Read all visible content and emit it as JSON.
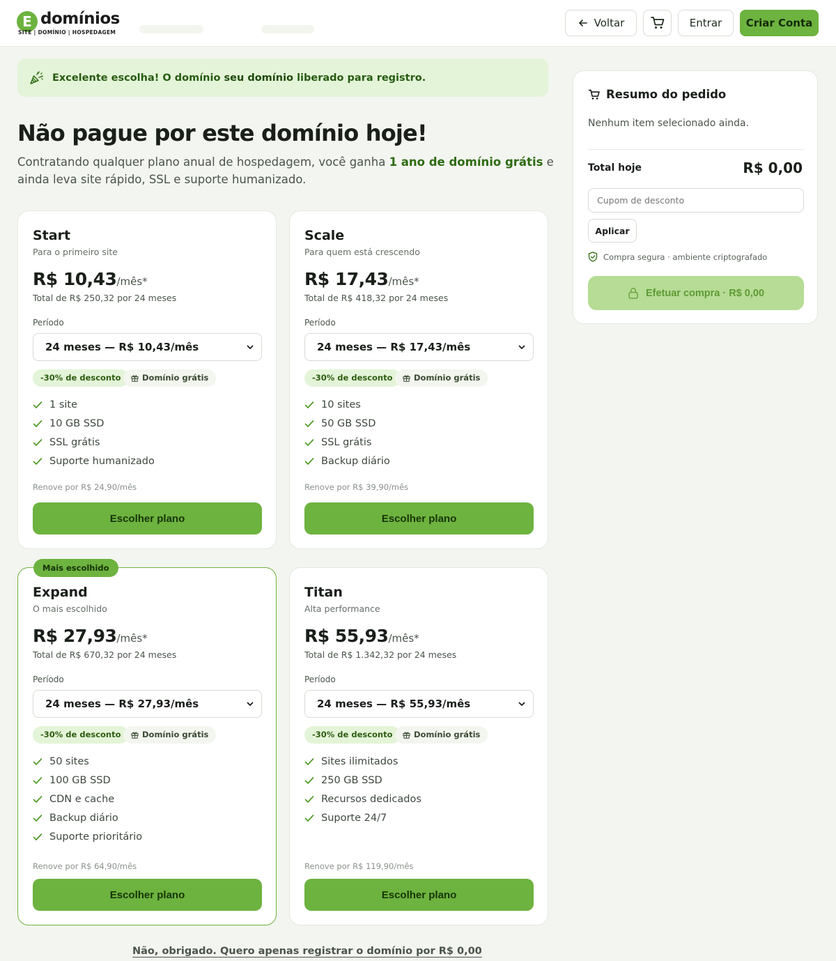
{
  "header": {
    "logo_letter": "E",
    "logo_word": "domínios",
    "logo_tagline": "SITE | DOMÍNIO | HOSPEDAGEM",
    "back_label": "Voltar",
    "login_label": "Entrar",
    "signup_label": "Criar Conta"
  },
  "banner": {
    "prefix": "Excelente escolha! O domínio ",
    "domain": "seu domínio",
    "suffix": " liberado para registro."
  },
  "hero": {
    "title": "Não pague por este domínio hoje!",
    "desc_before": "Contratando qualquer plano anual de hospedagem, você ganha ",
    "desc_highlight": "1 ano de domínio grátis",
    "desc_after": " e ainda leva site rápido, SSL e suporte humanizado."
  },
  "common": {
    "period_label": "Período",
    "per_month": "/mês*",
    "discount_chip": "-30% de desconto",
    "domain_chip": "Domínio grátis",
    "choose_label": "Escolher plano",
    "featured_ribbon": "Mais escolhido"
  },
  "plans": [
    {
      "name": "Start",
      "subtitle": "Para o primeiro site",
      "price": "R$ 10,43",
      "total": "Total de R$ 250,32 por 24 meses",
      "period": "24 meses — R$ 10,43/mês",
      "features": [
        "1 site",
        "10 GB SSD",
        "SSL grátis",
        "Suporte humanizado"
      ],
      "renew": "Renove por R$ 24,90/mês"
    },
    {
      "name": "Scale",
      "subtitle": "Para quem está crescendo",
      "price": "R$ 17,43",
      "total": "Total de R$ 418,32 por 24 meses",
      "period": "24 meses — R$ 17,43/mês",
      "features": [
        "10 sites",
        "50 GB SSD",
        "SSL grátis",
        "Backup diário"
      ],
      "renew": "Renove por R$ 39,90/mês"
    },
    {
      "name": "Expand",
      "subtitle": "O mais escolhido",
      "price": "R$ 27,93",
      "total": "Total de R$ 670,32 por 24 meses",
      "period": "24 meses — R$ 27,93/mês",
      "features": [
        "50 sites",
        "100 GB SSD",
        "CDN e cache",
        "Backup diário",
        "Suporte prioritário"
      ],
      "renew": "Renove por R$ 64,90/mês"
    },
    {
      "name": "Titan",
      "subtitle": "Alta performance",
      "price": "R$ 55,93",
      "total": "Total de R$ 1.342,32 por 24 meses",
      "period": "24 meses — R$ 55,93/mês",
      "features": [
        "Sites ilimitados",
        "250 GB SSD",
        "Recursos dedicados",
        "Suporte 24/7"
      ],
      "renew": "Renove por R$ 119,90/mês"
    }
  ],
  "summary": {
    "title": "Resumo do pedido",
    "empty": "Nenhum item selecionado ainda.",
    "total_label": "Total hoje",
    "total_value": "R$ 0,00",
    "coupon_placeholder": "Cupom de desconto",
    "apply_label": "Aplicar",
    "secure_text": "Compra segura · ambiente criptografado",
    "buy_label": "Efetuar compra · R$ 0,00"
  },
  "decline_link": "Não, obrigado. Quero apenas registrar o domínio por R$ 0,00",
  "colors": {
    "accent": "#6db33f",
    "accent_light": "#e4f4d8",
    "disabled": "#b6dc95"
  }
}
